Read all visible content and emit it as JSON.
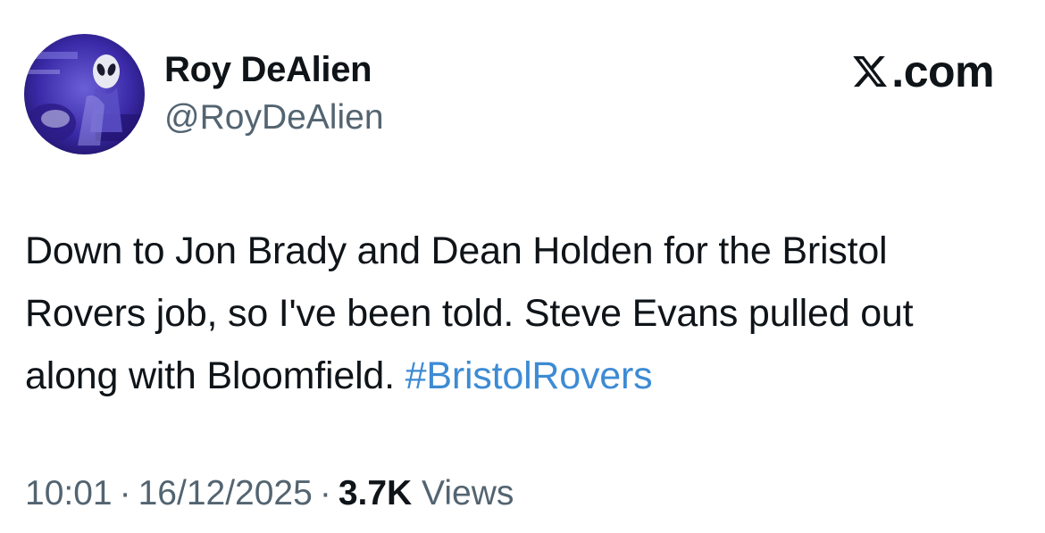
{
  "author": {
    "display_name": "Roy DeAlien",
    "handle": "@RoyDeAlien",
    "avatar_icon": "alien-avatar"
  },
  "brand": {
    "icon": "x-logo-icon",
    "text": ".com"
  },
  "tweet": {
    "text_plain": "Down to Jon Brady and Dean Holden for the Bristol Rovers job, so I've been told. Steve Evans pulled out along with Bloomfield.",
    "hashtag": "#BristolRovers"
  },
  "meta": {
    "time": "10:01",
    "separator": "·",
    "date": "16/12/2025",
    "views_count": "3.7K",
    "views_label": "Views"
  },
  "colors": {
    "text": "#0f1419",
    "secondary": "#536471",
    "hashtag": "#3d8bd4"
  }
}
